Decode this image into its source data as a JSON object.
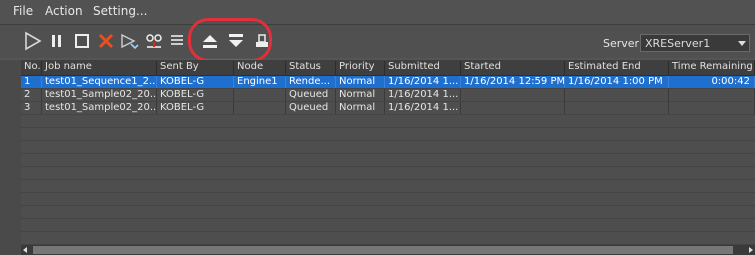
{
  "menubar": {
    "items": [
      {
        "label": "File"
      },
      {
        "label": "Action"
      },
      {
        "label": "Setting..."
      }
    ]
  },
  "toolbar": {
    "buttons": [
      {
        "name": "play-icon"
      },
      {
        "name": "pause-icon"
      },
      {
        "name": "stop-icon"
      },
      {
        "name": "delete-icon"
      },
      {
        "name": "send-icon"
      },
      {
        "name": "reassign-icon"
      },
      {
        "name": "list-icon"
      },
      {
        "name": "move-up-icon"
      },
      {
        "name": "move-down-icon"
      },
      {
        "name": "print-icon"
      }
    ],
    "server_label": "Server",
    "server_value": "XREServer1"
  },
  "table": {
    "columns": [
      "No.",
      "Job name",
      "Sent By",
      "Node",
      "Status",
      "Priority",
      "Submitted",
      "Started",
      "Estimated End",
      "Time Remaining"
    ],
    "rows": [
      {
        "no": "1",
        "job": "test01_Sequence1_2...",
        "sent_by": "KOBEL-G",
        "node": "Engine1",
        "status": "Rende...",
        "priority": "Normal",
        "submitted": "1/16/2014 1...",
        "started": "1/16/2014 12:59 PM",
        "est_end": "1/16/2014 1:00 PM",
        "remaining": "0:00:42"
      },
      {
        "no": "2",
        "job": "test01_Sample02_20...",
        "sent_by": "KOBEL-G",
        "node": "",
        "status": "Queued",
        "priority": "Normal",
        "submitted": "1/16/2014 1...",
        "started": "",
        "est_end": "",
        "remaining": ""
      },
      {
        "no": "3",
        "job": "test01_Sample02_20...",
        "sent_by": "KOBEL-G",
        "node": "",
        "status": "Queued",
        "priority": "Normal",
        "submitted": "1/16/2014 1...",
        "started": "",
        "est_end": "",
        "remaining": ""
      }
    ]
  },
  "colors": {
    "selection": "#1f6fcf",
    "highlight_ring": "#e0303a",
    "background": "#555555"
  }
}
